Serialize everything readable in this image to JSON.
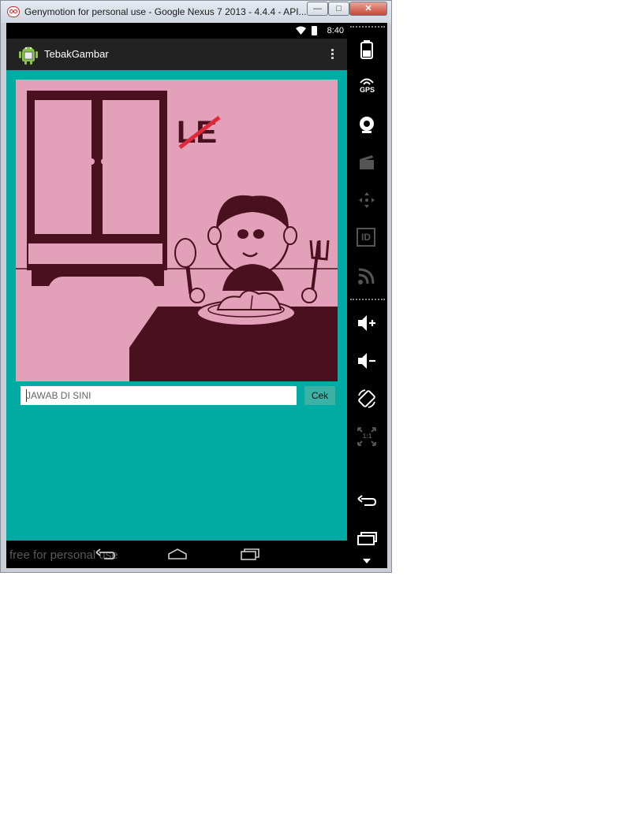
{
  "window": {
    "title": "Genymotion for personal use - Google Nexus 7 2013 - 4.4.4 - API...",
    "buttons": {
      "minimize": "—",
      "maximize": "□",
      "close": "✕"
    }
  },
  "status_bar": {
    "time": "8:40"
  },
  "action_bar": {
    "app_title": "TebakGambar"
  },
  "picture": {
    "caption_text": "LE"
  },
  "answer": {
    "placeholder": "JAWAB DI SINI",
    "value": ""
  },
  "check_button": {
    "label": "Cek"
  },
  "watermark": "free for personal use",
  "sidebar": {
    "gps_label": "GPS",
    "id_label": "ID",
    "pixel_perfect_label": "1:1"
  },
  "colors": {
    "content_bg": "#00aba3",
    "picture_bg": "#e3a1b9",
    "picture_dark": "#4a1020",
    "button_bg": "#3cb1a6"
  }
}
